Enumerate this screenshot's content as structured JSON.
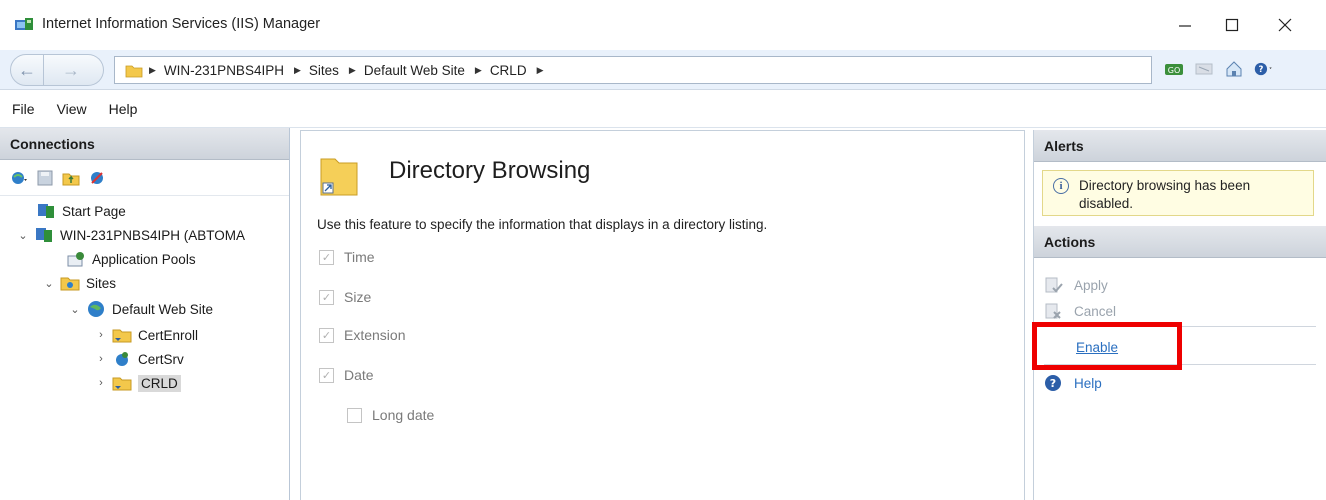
{
  "window": {
    "title": "Internet Information Services (IIS) Manager",
    "controls": [
      "—",
      "☐",
      "✕"
    ]
  },
  "address": {
    "crumbs": [
      "WIN-231PNBS4IPH",
      "Sites",
      "Default Web Site",
      "CRLD"
    ]
  },
  "menu": [
    "File",
    "View",
    "Help"
  ],
  "connections": {
    "header": "Connections",
    "tree": {
      "start_page": "Start Page",
      "server": "WIN-231PNBS4IPH (ABTOMA",
      "app_pools": "Application Pools",
      "sites": "Sites",
      "default_site": "Default Web Site",
      "certenroll": "CertEnroll",
      "certsrv": "CertSrv",
      "crld": "CRLD"
    }
  },
  "feature": {
    "title": "Directory Browsing",
    "description": "Use this feature to specify the information that displays in a directory listing.",
    "options": {
      "time": "Time",
      "size": "Size",
      "extension": "Extension",
      "date": "Date",
      "long_date": "Long date"
    }
  },
  "alerts": {
    "header": "Alerts",
    "message": "Directory browsing has been disabled."
  },
  "actions": {
    "header": "Actions",
    "apply": "Apply",
    "cancel": "Cancel",
    "enable": "Enable",
    "help": "Help"
  },
  "colors": {
    "link": "#2a6fc0",
    "highlight": "#ee0000",
    "alert_bg": "#fffde3"
  }
}
